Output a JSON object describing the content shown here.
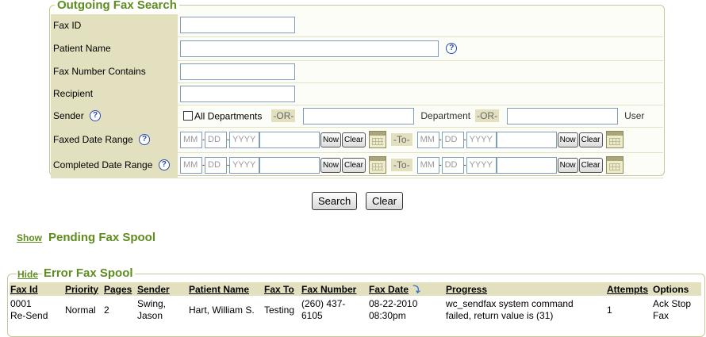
{
  "search": {
    "legend": "Outgoing Fax Search",
    "fax_id_label": "Fax ID",
    "patient_name_label": "Patient Name",
    "fax_number_label": "Fax Number Contains",
    "recipient_label": "Recipient",
    "sender_label": "Sender",
    "all_departments_label": "All Departments",
    "or_label": "-OR-",
    "department_label": "Department",
    "user_label": "User",
    "faxed_date_label": "Faxed Date Range",
    "completed_date_label": "Completed Date Range",
    "to_label": "-To-",
    "mm_placeholder": "MM",
    "dd_placeholder": "DD",
    "yyyy_placeholder": "YYYY",
    "now_label": "Now",
    "clear_label": "Clear",
    "help_glyph": "?"
  },
  "actions": {
    "search_label": "Search",
    "clear_label": "Clear"
  },
  "pending": {
    "toggle_label": "Show",
    "title": "Pending Fax Spool"
  },
  "error_spool": {
    "toggle_label": "Hide",
    "title": "Error Fax Spool",
    "columns": {
      "fax_id": "Fax Id",
      "priority": "Priority",
      "pages": "Pages",
      "sender": "Sender",
      "patient_name": "Patient Name",
      "fax_to": "Fax To",
      "fax_number": "Fax Number",
      "fax_date": "Fax Date",
      "progress": "Progress",
      "attempts": "Attempts",
      "options": "Options"
    },
    "row": {
      "fax_id": "0001",
      "resend": "Re-Send",
      "priority": "Normal",
      "pages": "2",
      "sender_line1": "Swing,",
      "sender_line2": "Jason",
      "patient_name": "Hart, William S.",
      "fax_to": "Testing",
      "fax_number_line1": "(260) 437-",
      "fax_number_line2": "6105",
      "fax_date_line1": "08-22-2010",
      "fax_date_line2": "08:30pm",
      "progress_line1": "wc_sendfax system command",
      "progress_line2": "failed, return value is (31)",
      "attempts": "1",
      "ack_label": "Ack",
      "stop_label": "Stop",
      "fax_label": "Fax"
    }
  },
  "colors": {
    "label_bg": "#e3e0c0",
    "title_green": "#5e8c1e",
    "help_blue": "#2a4dae"
  }
}
